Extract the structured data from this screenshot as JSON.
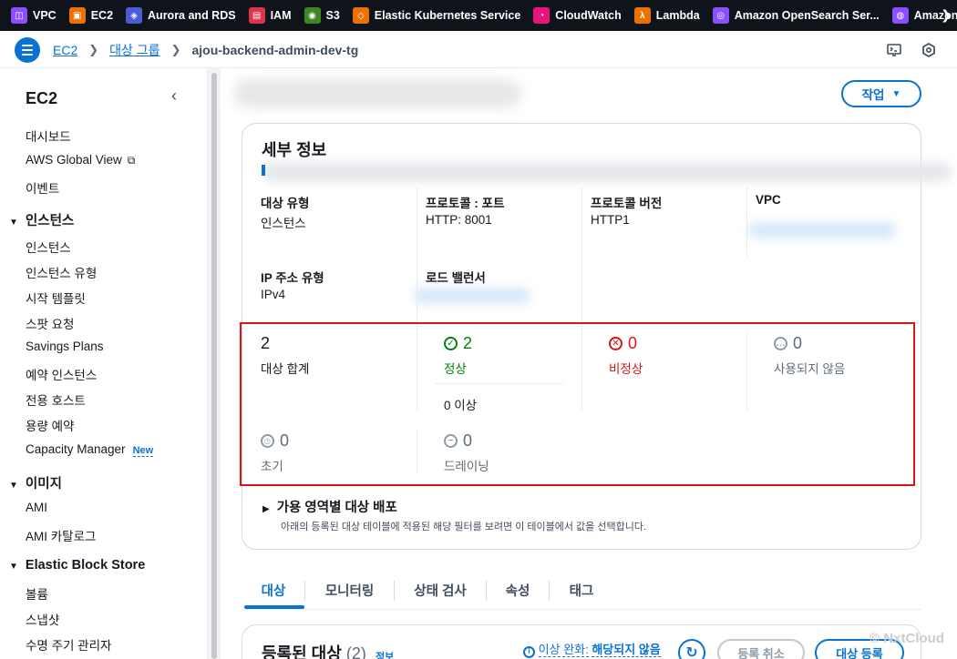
{
  "favorites": [
    {
      "label": "VPC",
      "color": "#8c4fff",
      "glyph": "◫"
    },
    {
      "label": "EC2",
      "color": "#ed7100",
      "glyph": "▣"
    },
    {
      "label": "Aurora and RDS",
      "color": "#4d5bd9",
      "glyph": "◈"
    },
    {
      "label": "IAM",
      "color": "#dd344c",
      "glyph": "▤"
    },
    {
      "label": "S3",
      "color": "#3f8624",
      "glyph": "◉"
    },
    {
      "label": "Elastic Kubernetes Service",
      "color": "#ed7100",
      "glyph": "◇"
    },
    {
      "label": "CloudWatch",
      "color": "#e7157b",
      "glyph": "◔"
    },
    {
      "label": "Lambda",
      "color": "#ed7100",
      "glyph": "λ"
    },
    {
      "label": "Amazon OpenSearch Ser...",
      "color": "#8c4fff",
      "glyph": "◎"
    },
    {
      "label": "Amazon S",
      "color": "#8c4fff",
      "glyph": "◍"
    }
  ],
  "breadcrumb": {
    "root": "EC2",
    "group": "대상 그룹",
    "current": "ajou-backend-admin-dev-tg"
  },
  "sidebar": {
    "title": "EC2",
    "top_items": [
      "대시보드",
      "AWS Global View",
      "이벤트"
    ],
    "sections": [
      {
        "title": "인스턴스",
        "items": [
          "인스턴스",
          "인스턴스 유형",
          "시작 템플릿",
          "스팟 요청",
          "Savings Plans",
          "예약 인스턴스",
          "전용 호스트",
          "용량 예약",
          "Capacity Manager"
        ]
      },
      {
        "title": "이미지",
        "items": [
          "AMI",
          "AMI 카탈로그"
        ]
      },
      {
        "title": "Elastic Block Store",
        "items": [
          "볼륨",
          "스냅샷",
          "수명 주기 관리자"
        ]
      }
    ],
    "new_badge": "New"
  },
  "actions_button": "작업",
  "details": {
    "title": "세부 정보",
    "target_type_label": "대상 유형",
    "target_type_value": "인스턴스",
    "protocol_port_label": "프로토콜 : 포트",
    "protocol_port_value": "HTTP: 8001",
    "protocol_version_label": "프로토콜 버전",
    "protocol_version_value": "HTTP1",
    "vpc_label": "VPC",
    "ip_type_label": "IP 주소 유형",
    "ip_type_value": "IPv4",
    "lb_label": "로드 밸런서"
  },
  "stats": {
    "total": {
      "value": "2",
      "label": "대상 합계"
    },
    "healthy": {
      "value": "2",
      "label": "정상",
      "sub": "0 이상"
    },
    "unhealthy": {
      "value": "0",
      "label": "비정상"
    },
    "unused": {
      "value": "0",
      "label": "사용되지 않음"
    },
    "initial": {
      "value": "0",
      "label": "초기"
    },
    "draining": {
      "value": "0",
      "label": "드레이닝"
    }
  },
  "az_distribution": {
    "title": "가용 영역별 대상 배포",
    "desc": "아래의 등록된 대상 테이블에 적용된 해당 필터를 보려면 이 테이블에서 값을 선택합니다."
  },
  "tabs": [
    "대상",
    "모니터링",
    "상태 검사",
    "속성",
    "태그"
  ],
  "registered": {
    "title": "등록된 대상",
    "count": "(2)",
    "info": "정보",
    "mitigation_label": "이상 완화:",
    "mitigation_value": "해당되지 않음",
    "deregister": "등록 취소",
    "register": "대상 등록"
  },
  "watermark": "© NxtCloud",
  "colors": {
    "accent": "#0972d3",
    "success": "#037f0c",
    "error": "#d91515",
    "neutral": "#8d99a8",
    "highlight": "#d91515"
  }
}
